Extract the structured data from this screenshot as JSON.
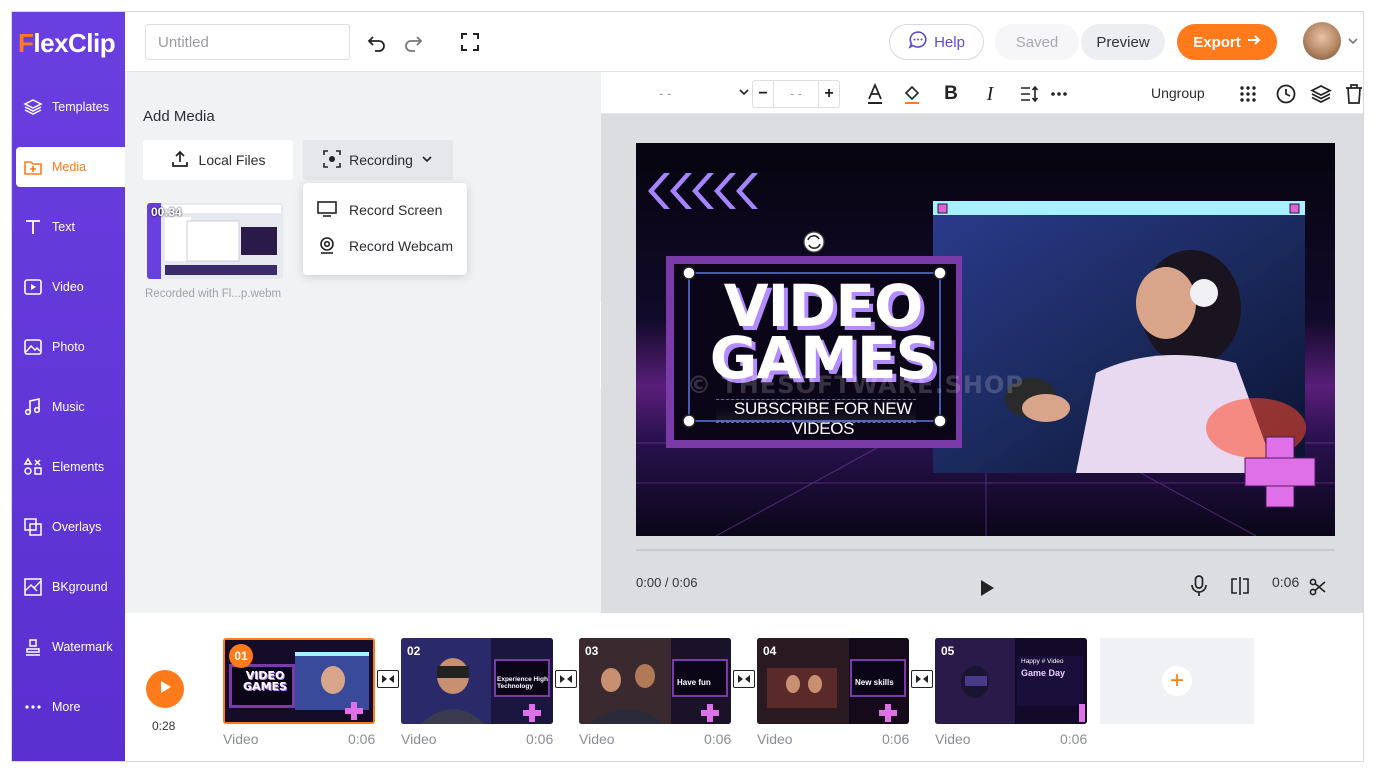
{
  "app": {
    "logo": "FlexClip"
  },
  "sidebar": {
    "items": [
      {
        "label": "Templates",
        "icon": "layers-icon"
      },
      {
        "label": "Media",
        "icon": "folder-icon"
      },
      {
        "label": "Text",
        "icon": "text-icon"
      },
      {
        "label": "Video",
        "icon": "video-icon"
      },
      {
        "label": "Photo",
        "icon": "photo-icon"
      },
      {
        "label": "Music",
        "icon": "music-icon"
      },
      {
        "label": "Elements",
        "icon": "elements-icon"
      },
      {
        "label": "Overlays",
        "icon": "overlays-icon"
      },
      {
        "label": "BKground",
        "icon": "background-icon"
      },
      {
        "label": "Watermark",
        "icon": "stamp-icon"
      },
      {
        "label": "More",
        "icon": "more-icon"
      }
    ],
    "active": "Media"
  },
  "topbar": {
    "title_placeholder": "Untitled",
    "help_label": "Help",
    "saved_label": "Saved",
    "preview_label": "Preview",
    "export_label": "Export"
  },
  "media_panel": {
    "title": "Add Media",
    "local_files_label": "Local Files",
    "recording_label": "Recording",
    "dropdown": {
      "record_screen": "Record Screen",
      "record_webcam": "Record Webcam"
    },
    "media_item": {
      "duration": "00:34",
      "name": "Recorded with Fl...p.webm"
    }
  },
  "format_toolbar": {
    "font_value": "- -",
    "size_value": "- -",
    "ungroup_label": "Ungroup"
  },
  "canvas": {
    "headline_line1": "VIDEO",
    "headline_line2": "GAMES",
    "subtitle": "SUBSCRIBE FOR NEW VIDEOS",
    "watermark": "© THESOFTWARE.SHOP"
  },
  "player": {
    "time": "0:00 / 0:06",
    "clip_duration": "0:06"
  },
  "timeline": {
    "total_time": "0:28",
    "clips": [
      {
        "num": "01",
        "label": "Video",
        "duration": "0:06"
      },
      {
        "num": "02",
        "label": "Video",
        "duration": "0:06"
      },
      {
        "num": "03",
        "label": "Video",
        "duration": "0:06"
      },
      {
        "num": "04",
        "label": "Video",
        "duration": "0:06"
      },
      {
        "num": "05",
        "label": "Video",
        "duration": "0:06"
      }
    ],
    "clip_texts": {
      "c1_title": "VIDEO GAMES",
      "c2_title": "Experience High Technology",
      "c3_title": "Have fun",
      "c4_title": "New skills",
      "c5_top": "Happy # Video",
      "c5_title": "Game Day"
    }
  },
  "colors": {
    "accent": "#ff7a1a",
    "sidebar": "#6a3fe0",
    "canvas_purple": "#b48cff"
  }
}
